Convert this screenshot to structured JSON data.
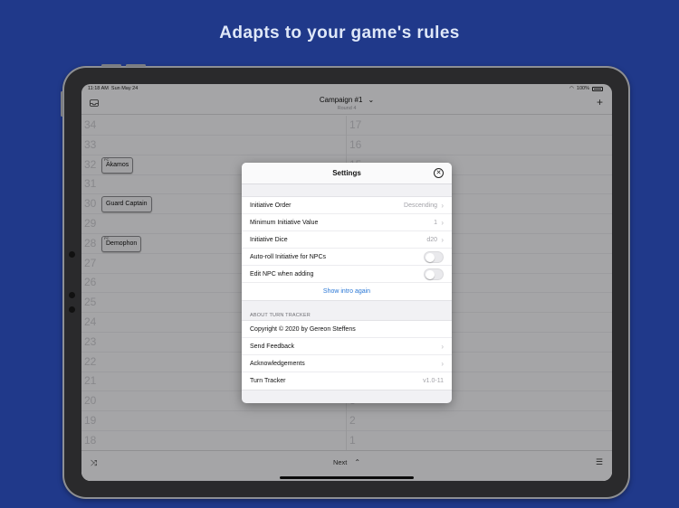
{
  "headline": "Adapts to your game's rules",
  "status_bar": {
    "time": "11:18 AM",
    "date": "Sun May 24",
    "battery": "100%"
  },
  "nav": {
    "title": "Campaign #1",
    "subtitle": "Round 4"
  },
  "left_column": [
    {
      "num": "34"
    },
    {
      "num": "33"
    },
    {
      "num": "32",
      "chip": "Akamos",
      "tag": "PC"
    },
    {
      "num": "31"
    },
    {
      "num": "30",
      "chip": "Guard Captain"
    },
    {
      "num": "29"
    },
    {
      "num": "28",
      "chip": "Demophon",
      "tag": "PC"
    },
    {
      "num": "27"
    },
    {
      "num": "26"
    },
    {
      "num": "25"
    },
    {
      "num": "24"
    },
    {
      "num": "23"
    },
    {
      "num": "22"
    },
    {
      "num": "21"
    },
    {
      "num": "20"
    },
    {
      "num": "19"
    },
    {
      "num": "18"
    }
  ],
  "right_column": [
    {
      "num": "17"
    },
    {
      "num": "16"
    },
    {
      "num": "15"
    },
    {
      "num": "14"
    },
    {
      "num": "13"
    },
    {
      "num": "12"
    },
    {
      "num": "11"
    },
    {
      "num": "10"
    },
    {
      "num": "9"
    },
    {
      "num": "8"
    },
    {
      "num": "7"
    },
    {
      "num": "6"
    },
    {
      "num": "5"
    },
    {
      "num": "4"
    },
    {
      "num": "3"
    },
    {
      "num": "2"
    },
    {
      "num": "1"
    }
  ],
  "toolbar": {
    "next_label": "Next"
  },
  "settings": {
    "title": "Settings",
    "rows": [
      {
        "label": "Initiative Order",
        "value": "Descending",
        "kind": "nav"
      },
      {
        "label": "Minimum Initiative Value",
        "value": "1",
        "kind": "nav"
      },
      {
        "label": "Initiative Dice",
        "value": "d20",
        "kind": "nav"
      },
      {
        "label": "Auto-roll Initiative for NPCs",
        "kind": "toggle",
        "on": false
      },
      {
        "label": "Edit NPC when adding",
        "kind": "toggle",
        "on": false
      },
      {
        "label": "Show intro again",
        "kind": "link"
      }
    ],
    "about_header": "ABOUT TURN TRACKER",
    "about_rows": [
      {
        "label": "Copyright © 2020 by Gereon Steffens",
        "kind": "static"
      },
      {
        "label": "Send Feedback",
        "kind": "nav"
      },
      {
        "label": "Acknowledgements",
        "kind": "nav"
      },
      {
        "label": "Turn Tracker",
        "value": "v1.0-11",
        "kind": "static"
      }
    ]
  },
  "colors": {
    "background": "#20398a",
    "link": "#2b78d6"
  }
}
